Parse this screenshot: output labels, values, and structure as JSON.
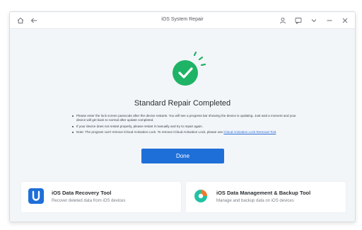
{
  "window": {
    "title": "iOS System Repair"
  },
  "titlebar": {
    "left_icons": [
      "home-icon",
      "back-arrow-icon"
    ],
    "right_icons": [
      "user-icon",
      "feedback-icon",
      "menu-icon",
      "minimize-icon",
      "close-icon"
    ]
  },
  "status": {
    "icon": "check-circle-icon",
    "heading": "Standard Repair Completed",
    "accent_color": "#1fb366"
  },
  "notes": [
    {
      "text": "Please enter the lock screen passcode after the device restarts. You will see a progress bar showing the device is updating. Just wait a moment and your device will get back to normal after update completed."
    },
    {
      "text": "If your device does not restart properly, please restart it manually and try to repair again."
    },
    {
      "text": "Note: The program can't remove iCloud Activation Lock. To remove iCloud Activation Lock, please use ",
      "link": "iCloud Activation Lock Removal Tool",
      "suffix": "."
    }
  ],
  "done_button": {
    "label": "Done",
    "color": "#1f6fd8"
  },
  "cards": [
    {
      "title": "iOS Data Recovery Tool",
      "description": "Recover deleted data from iOS devices",
      "icon": "data-recovery-icon"
    },
    {
      "title": "iOS Data Management & Backup Tool",
      "description": "Manage and backup data on iOS devices",
      "icon": "data-management-icon"
    }
  ]
}
